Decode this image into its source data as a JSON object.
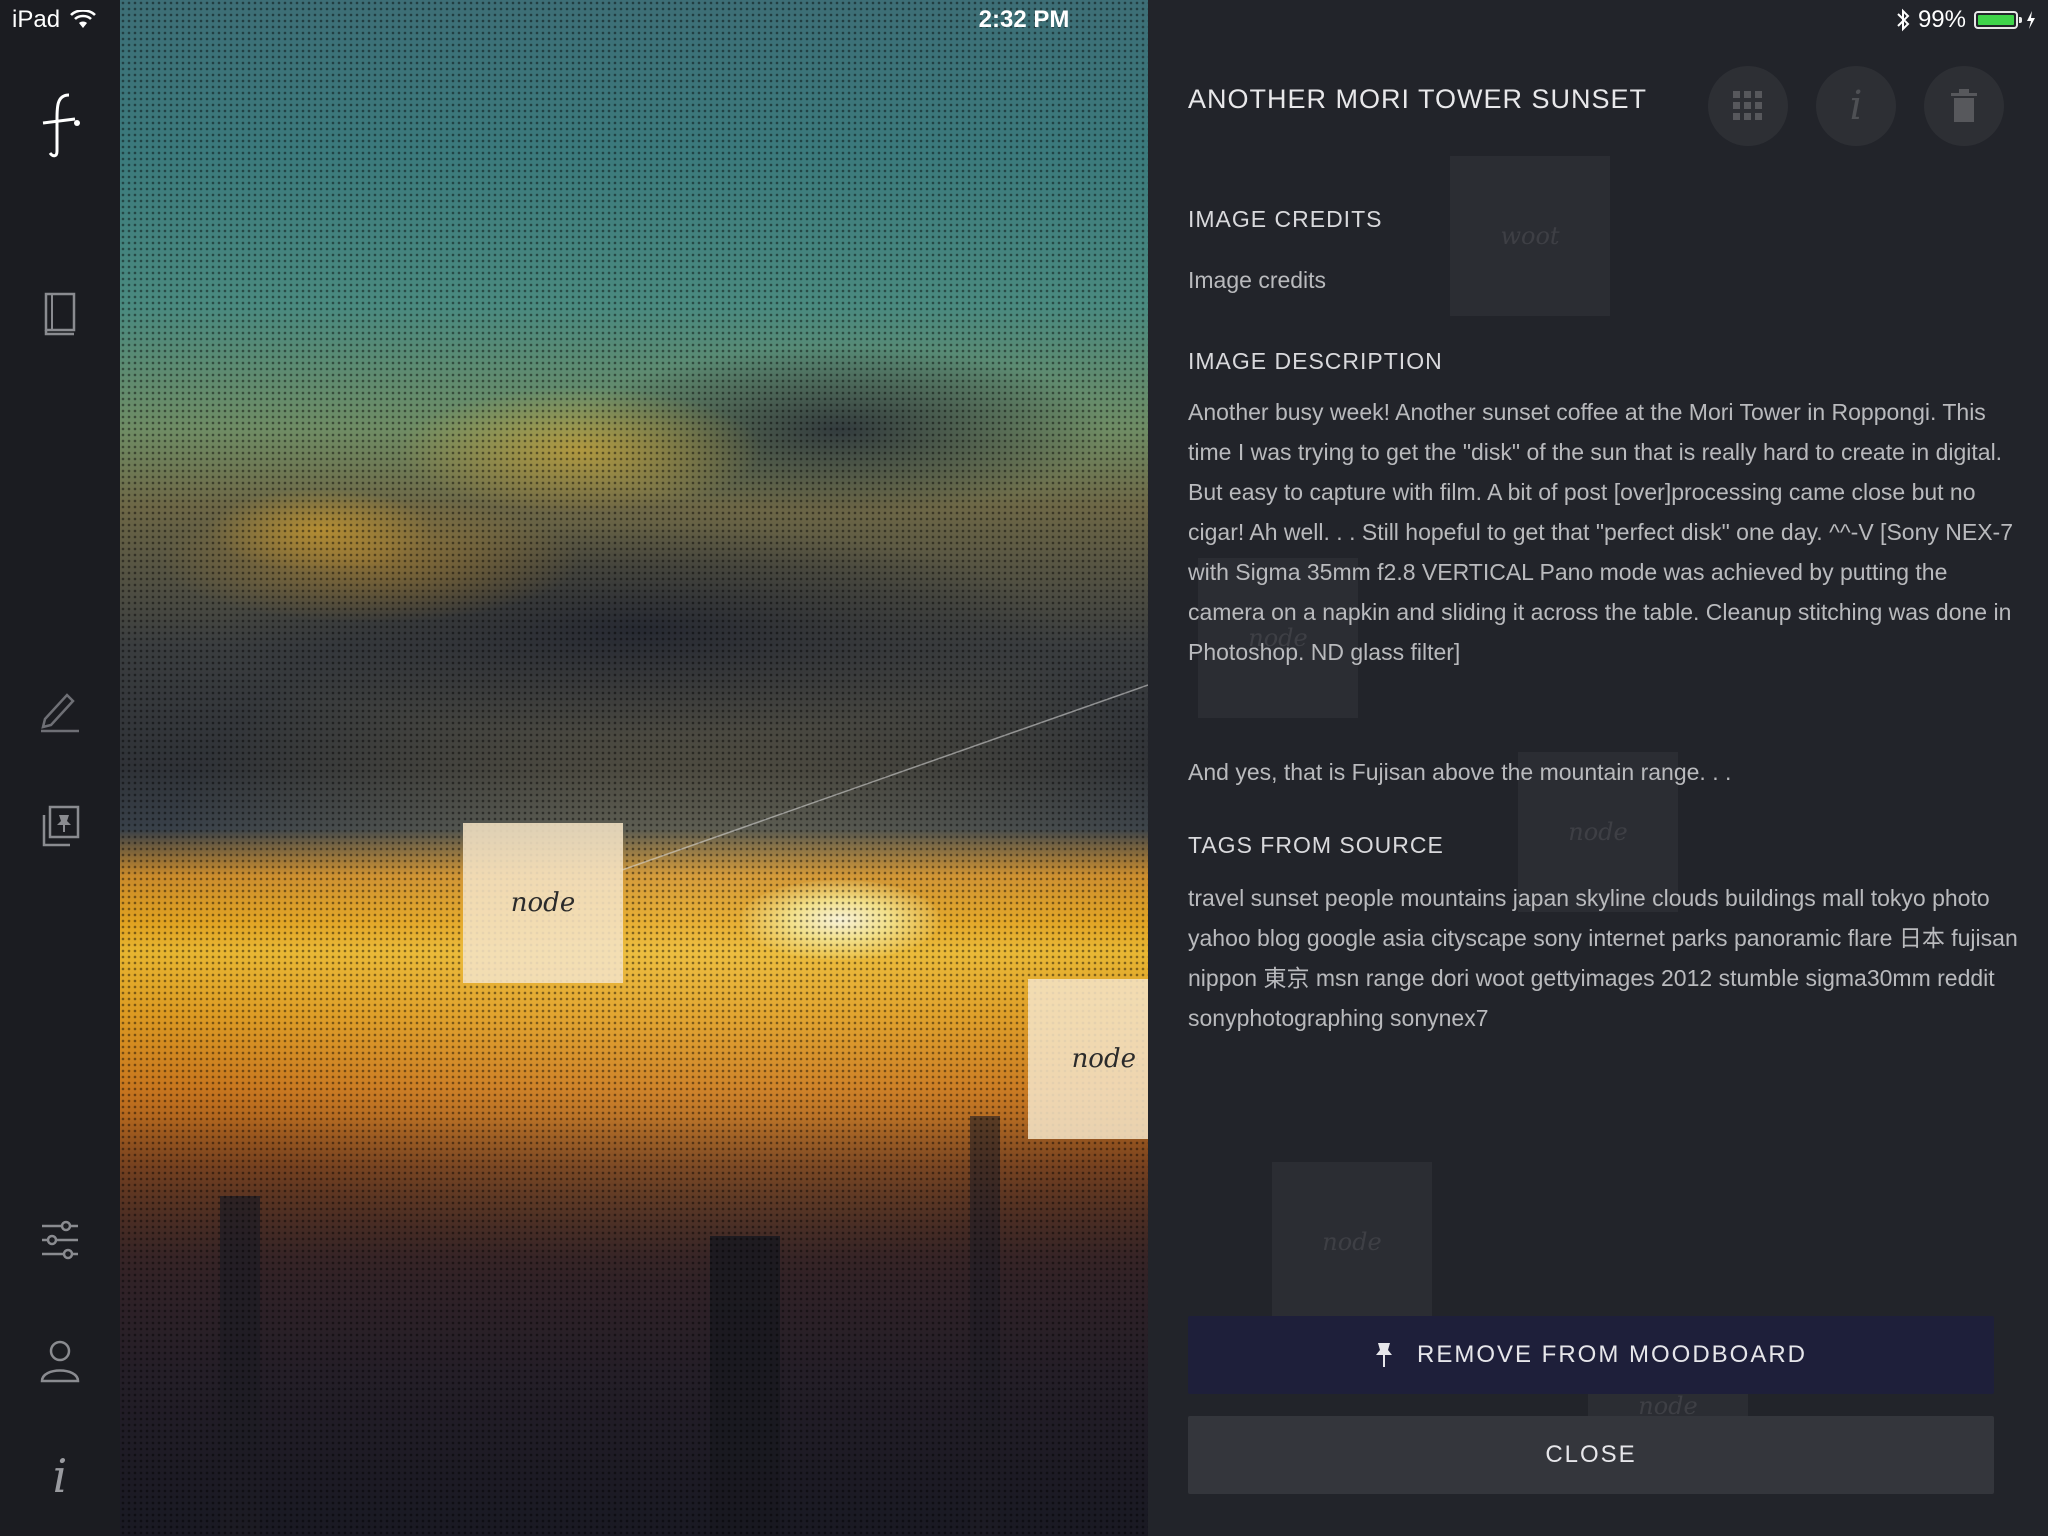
{
  "statusbar": {
    "device": "iPad",
    "time": "2:32 PM",
    "battery": "99%",
    "battery_level": 0.99
  },
  "rail": {
    "items": [
      {
        "name": "logo",
        "icon": "fork-logo-icon"
      },
      {
        "name": "library",
        "icon": "book-icon"
      },
      {
        "name": "edit",
        "icon": "pencil-icon"
      },
      {
        "name": "moodboards",
        "icon": "pinned-stack-icon"
      },
      {
        "name": "settings",
        "icon": "sliders-icon"
      },
      {
        "name": "profile",
        "icon": "user-icon"
      },
      {
        "name": "info",
        "icon": "info-icon"
      }
    ]
  },
  "photo": {
    "nodes": [
      "node",
      "node"
    ]
  },
  "panel": {
    "title": "ANOTHER MORI TOWER SUNSET",
    "toolbar": {
      "grid_icon": "grid-icon",
      "info_icon": "info-icon",
      "trash_icon": "trash-icon"
    },
    "ghost_nodes": [
      "woot",
      "node",
      "node",
      "node",
      "node"
    ],
    "credits_label": "IMAGE CREDITS",
    "credits_value": "Image credits",
    "description_label": "IMAGE DESCRIPTION",
    "description_p1": "Another busy week! Another sunset coffee at the Mori Tower in Roppongi. This time I was trying to get the \"disk\" of the sun that is really hard to create in digital. But easy to capture with film. A bit of post [over]processing came close but no cigar! Ah well. . . Still hopeful to get that \"perfect disk\" one day. ^^-V [Sony NEX-7 with Sigma 35mm f2.8 VERTICAL Pano mode was achieved by putting the camera on a napkin and sliding it across the table. Cleanup stitching was done in Photoshop. ND glass filter]",
    "description_p2": "And yes, that is Fujisan above the mountain range. . .",
    "tags_label": "TAGS FROM SOURCE",
    "tags": "travel sunset people mountains japan skyline clouds buildings mall tokyo photo yahoo blog google asia cityscape sony internet parks panoramic flare 日本 fujisan nippon 東京 msn range dori woot gettyimages 2012 stumble sigma30mm reddit sonyphotographing sonynex7",
    "remove_label": "REMOVE FROM MOODBOARD",
    "remove_icon": "pin-icon",
    "close_label": "CLOSE"
  },
  "colors": {
    "panel_bg": "#22242a",
    "primary_button": "#1e1f3a",
    "secondary_button": "#34363c",
    "battery_green": "#3fd44a"
  }
}
